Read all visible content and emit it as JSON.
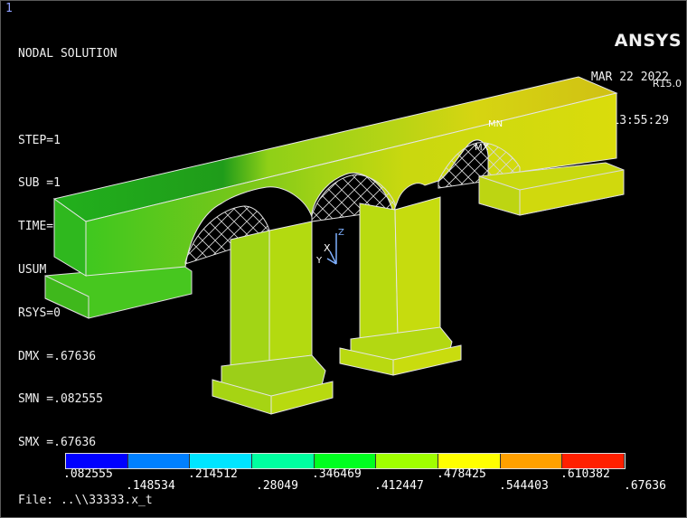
{
  "window_number": "1",
  "brand": {
    "name": "ANSYS",
    "version": "R15.0"
  },
  "date": "MAR 22 2022",
  "time": "13:55:29",
  "info": [
    "NODAL SOLUTION",
    "",
    "STEP=1",
    "SUB =1",
    "TIME=1",
    "USUM      (AVG)",
    "RSYS=0",
    "DMX =.67636",
    "SMN =.082555",
    "SMX =.67636"
  ],
  "labels": {
    "mn": "MN",
    "mx": "MX",
    "axis_x": "X",
    "axis_y": "Y",
    "axis_z": "Z"
  },
  "legend": {
    "colors": [
      "#0000ff",
      "#0080ff",
      "#00e5ff",
      "#00ffa0",
      "#00ff20",
      "#a0ff00",
      "#ffff00",
      "#ffa000",
      "#ff2000"
    ],
    "ticks_top": [
      ".082555",
      ".214512",
      ".346469",
      ".478425",
      ".610382"
    ],
    "ticks_bottom": [
      ".148534",
      ".28049",
      ".412447",
      ".544403",
      ".67636"
    ]
  },
  "file_label": "File: ..\\\\33333.x_t"
}
